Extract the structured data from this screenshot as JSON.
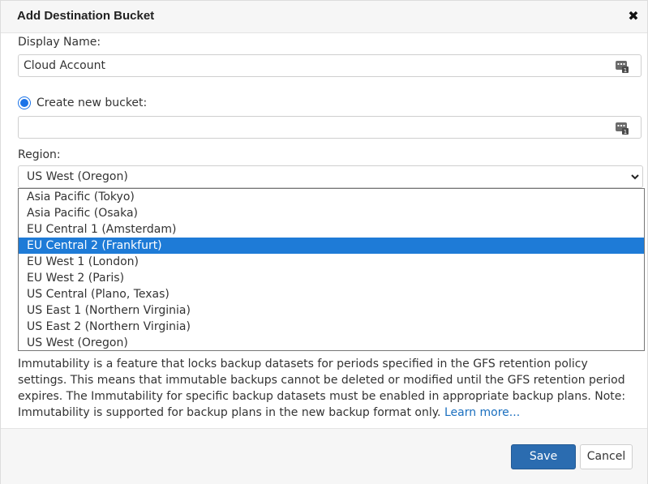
{
  "dialog": {
    "title": "Add Destination Bucket",
    "close_icon": "close-icon"
  },
  "display_name": {
    "label": "Display Name:",
    "value": "Cloud Account",
    "icon": "text-variable-icon"
  },
  "create_bucket": {
    "label": "Create new bucket:",
    "value": "",
    "selected": true,
    "icon": "text-variable-icon"
  },
  "region": {
    "label": "Region:",
    "selected": "US West (Oregon)",
    "options": [
      "Asia Pacific (Tokyo)",
      "Asia Pacific (Osaka)",
      "EU Central 1 (Amsterdam)",
      "EU Central 2 (Frankfurt)",
      "EU West 1 (London)",
      "EU West 2 (Paris)",
      "US Central (Plano, Texas)",
      "US East 1 (Northern Virginia)",
      "US East 2 (Northern Virginia)",
      "US West (Oregon)"
    ],
    "highlighted": "EU Central 2 (Frankfurt)"
  },
  "immutability": {
    "text": "Immutability is a feature that locks backup datasets for periods specified in the GFS retention policy settings. This means that immutable backups cannot be deleted or modified until the GFS retention period expires. The Immutability for specific backup datasets must be enabled in appropriate backup plans. Note: Immutability is supported for backup plans in the new backup format only.",
    "link": "Learn more..."
  },
  "footer": {
    "save_label": "Save",
    "cancel_label": "Cancel"
  },
  "colors": {
    "accent": "#1e7bd7",
    "primary_button": "#2b6cb0",
    "link": "#1a6fbf"
  }
}
